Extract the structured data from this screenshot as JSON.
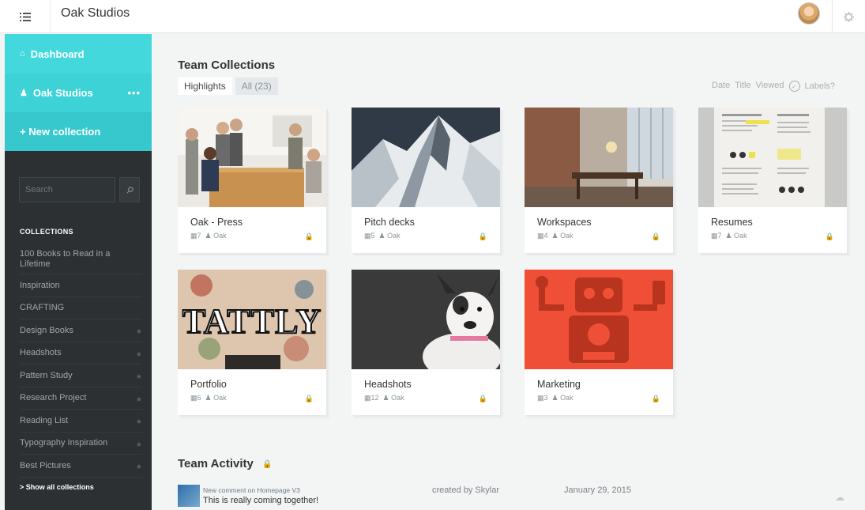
{
  "header": {
    "title": "Oak Studios"
  },
  "sidebar": {
    "dashboard": "Dashboard",
    "org": "Oak Studios",
    "new_collection": "+ New collection",
    "search_placeholder": "Search",
    "collections_heading": "COLLECTIONS",
    "collections": [
      {
        "label": "100 Books to Read in a Lifetime",
        "starred": false
      },
      {
        "label": "Inspiration",
        "starred": false
      },
      {
        "label": "CRAFTING",
        "starred": false
      },
      {
        "label": "Design Books",
        "starred": true
      },
      {
        "label": "Headshots",
        "starred": true
      },
      {
        "label": "Pattern Study",
        "starred": true
      },
      {
        "label": "Research Project",
        "starred": true
      },
      {
        "label": "Reading List",
        "starred": true
      },
      {
        "label": "Typography Inspiration",
        "starred": true
      },
      {
        "label": "Best Pictures",
        "starred": true
      }
    ],
    "show_all": "> Show all collections"
  },
  "main": {
    "title": "Team Collections",
    "tabs": [
      "Highlights",
      "All (23)"
    ],
    "sort_options": [
      "Date",
      "Title",
      "Viewed"
    ],
    "labels_toggle": "Labels?",
    "cards": [
      {
        "name": "Oak - Press",
        "count": "7",
        "owner": "Oak",
        "image": "team-photo"
      },
      {
        "name": "Pitch decks",
        "count": "5",
        "owner": "Oak",
        "image": "mountain"
      },
      {
        "name": "Workspaces",
        "count": "4",
        "owner": "Oak",
        "image": "interior"
      },
      {
        "name": "Resumes",
        "count": "7",
        "owner": "Oak",
        "image": "document"
      },
      {
        "name": "Portfolio",
        "count": "6",
        "owner": "Oak",
        "image": "tattly"
      },
      {
        "name": "Headshots",
        "count": "12",
        "owner": "Oak",
        "image": "dog"
      },
      {
        "name": "Marketing",
        "count": "3",
        "owner": "Oak",
        "image": "robot"
      }
    ],
    "tattly_text": "TATTLY"
  },
  "activity": {
    "title": "Team Activity",
    "items": [
      {
        "heading": "New comment on Homepage V3",
        "text": "This is really coming together!",
        "creator": "created by Skylar",
        "date": "January 29, 2015"
      }
    ]
  },
  "colors": {
    "accent": "#3dd2d6",
    "sidebar": "#2c3033",
    "background": "#f3f4f4"
  }
}
